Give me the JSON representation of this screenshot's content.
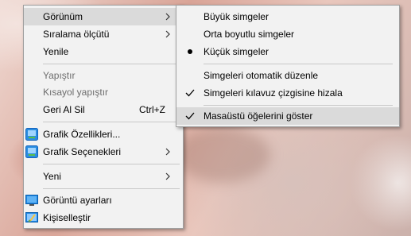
{
  "main_menu": {
    "items": [
      {
        "label": "Görünüm",
        "has_submenu": true,
        "highlighted": true
      },
      {
        "label": "Sıralama ölçütü",
        "has_submenu": true
      },
      {
        "label": "Yenile"
      },
      {
        "label": "Yapıştır",
        "disabled": true
      },
      {
        "label": "Kısayol yapıştır",
        "disabled": true
      },
      {
        "label": "Geri Al Sil",
        "shortcut": "Ctrl+Z"
      },
      {
        "label": "Grafik Özellikleri...",
        "icon": "graphics-properties-icon"
      },
      {
        "label": "Grafik Seçenekleri",
        "icon": "graphics-options-icon",
        "has_submenu": true
      },
      {
        "label": "Yeni",
        "has_submenu": true
      },
      {
        "label": "Görüntü ayarları",
        "icon": "display-settings-icon"
      },
      {
        "label": "Kişiselleştir",
        "icon": "personalize-icon"
      }
    ]
  },
  "sub_menu": {
    "items": [
      {
        "label": "Büyük simgeler"
      },
      {
        "label": "Orta boyutlu simgeler"
      },
      {
        "label": "Küçük simgeler",
        "mark": "bullet"
      },
      {
        "label": "Simgeleri otomatik düzenle"
      },
      {
        "label": "Simgeleri kılavuz çizgisine hizala",
        "mark": "check"
      },
      {
        "label": "Masaüstü öğelerini göster",
        "mark": "check",
        "highlighted": true
      }
    ]
  },
  "colors": {
    "menu_background": "#f2f2f2",
    "highlight": "#dadada",
    "disabled_text": "#6d6d6d",
    "icon_blue": "#1e88e5"
  }
}
